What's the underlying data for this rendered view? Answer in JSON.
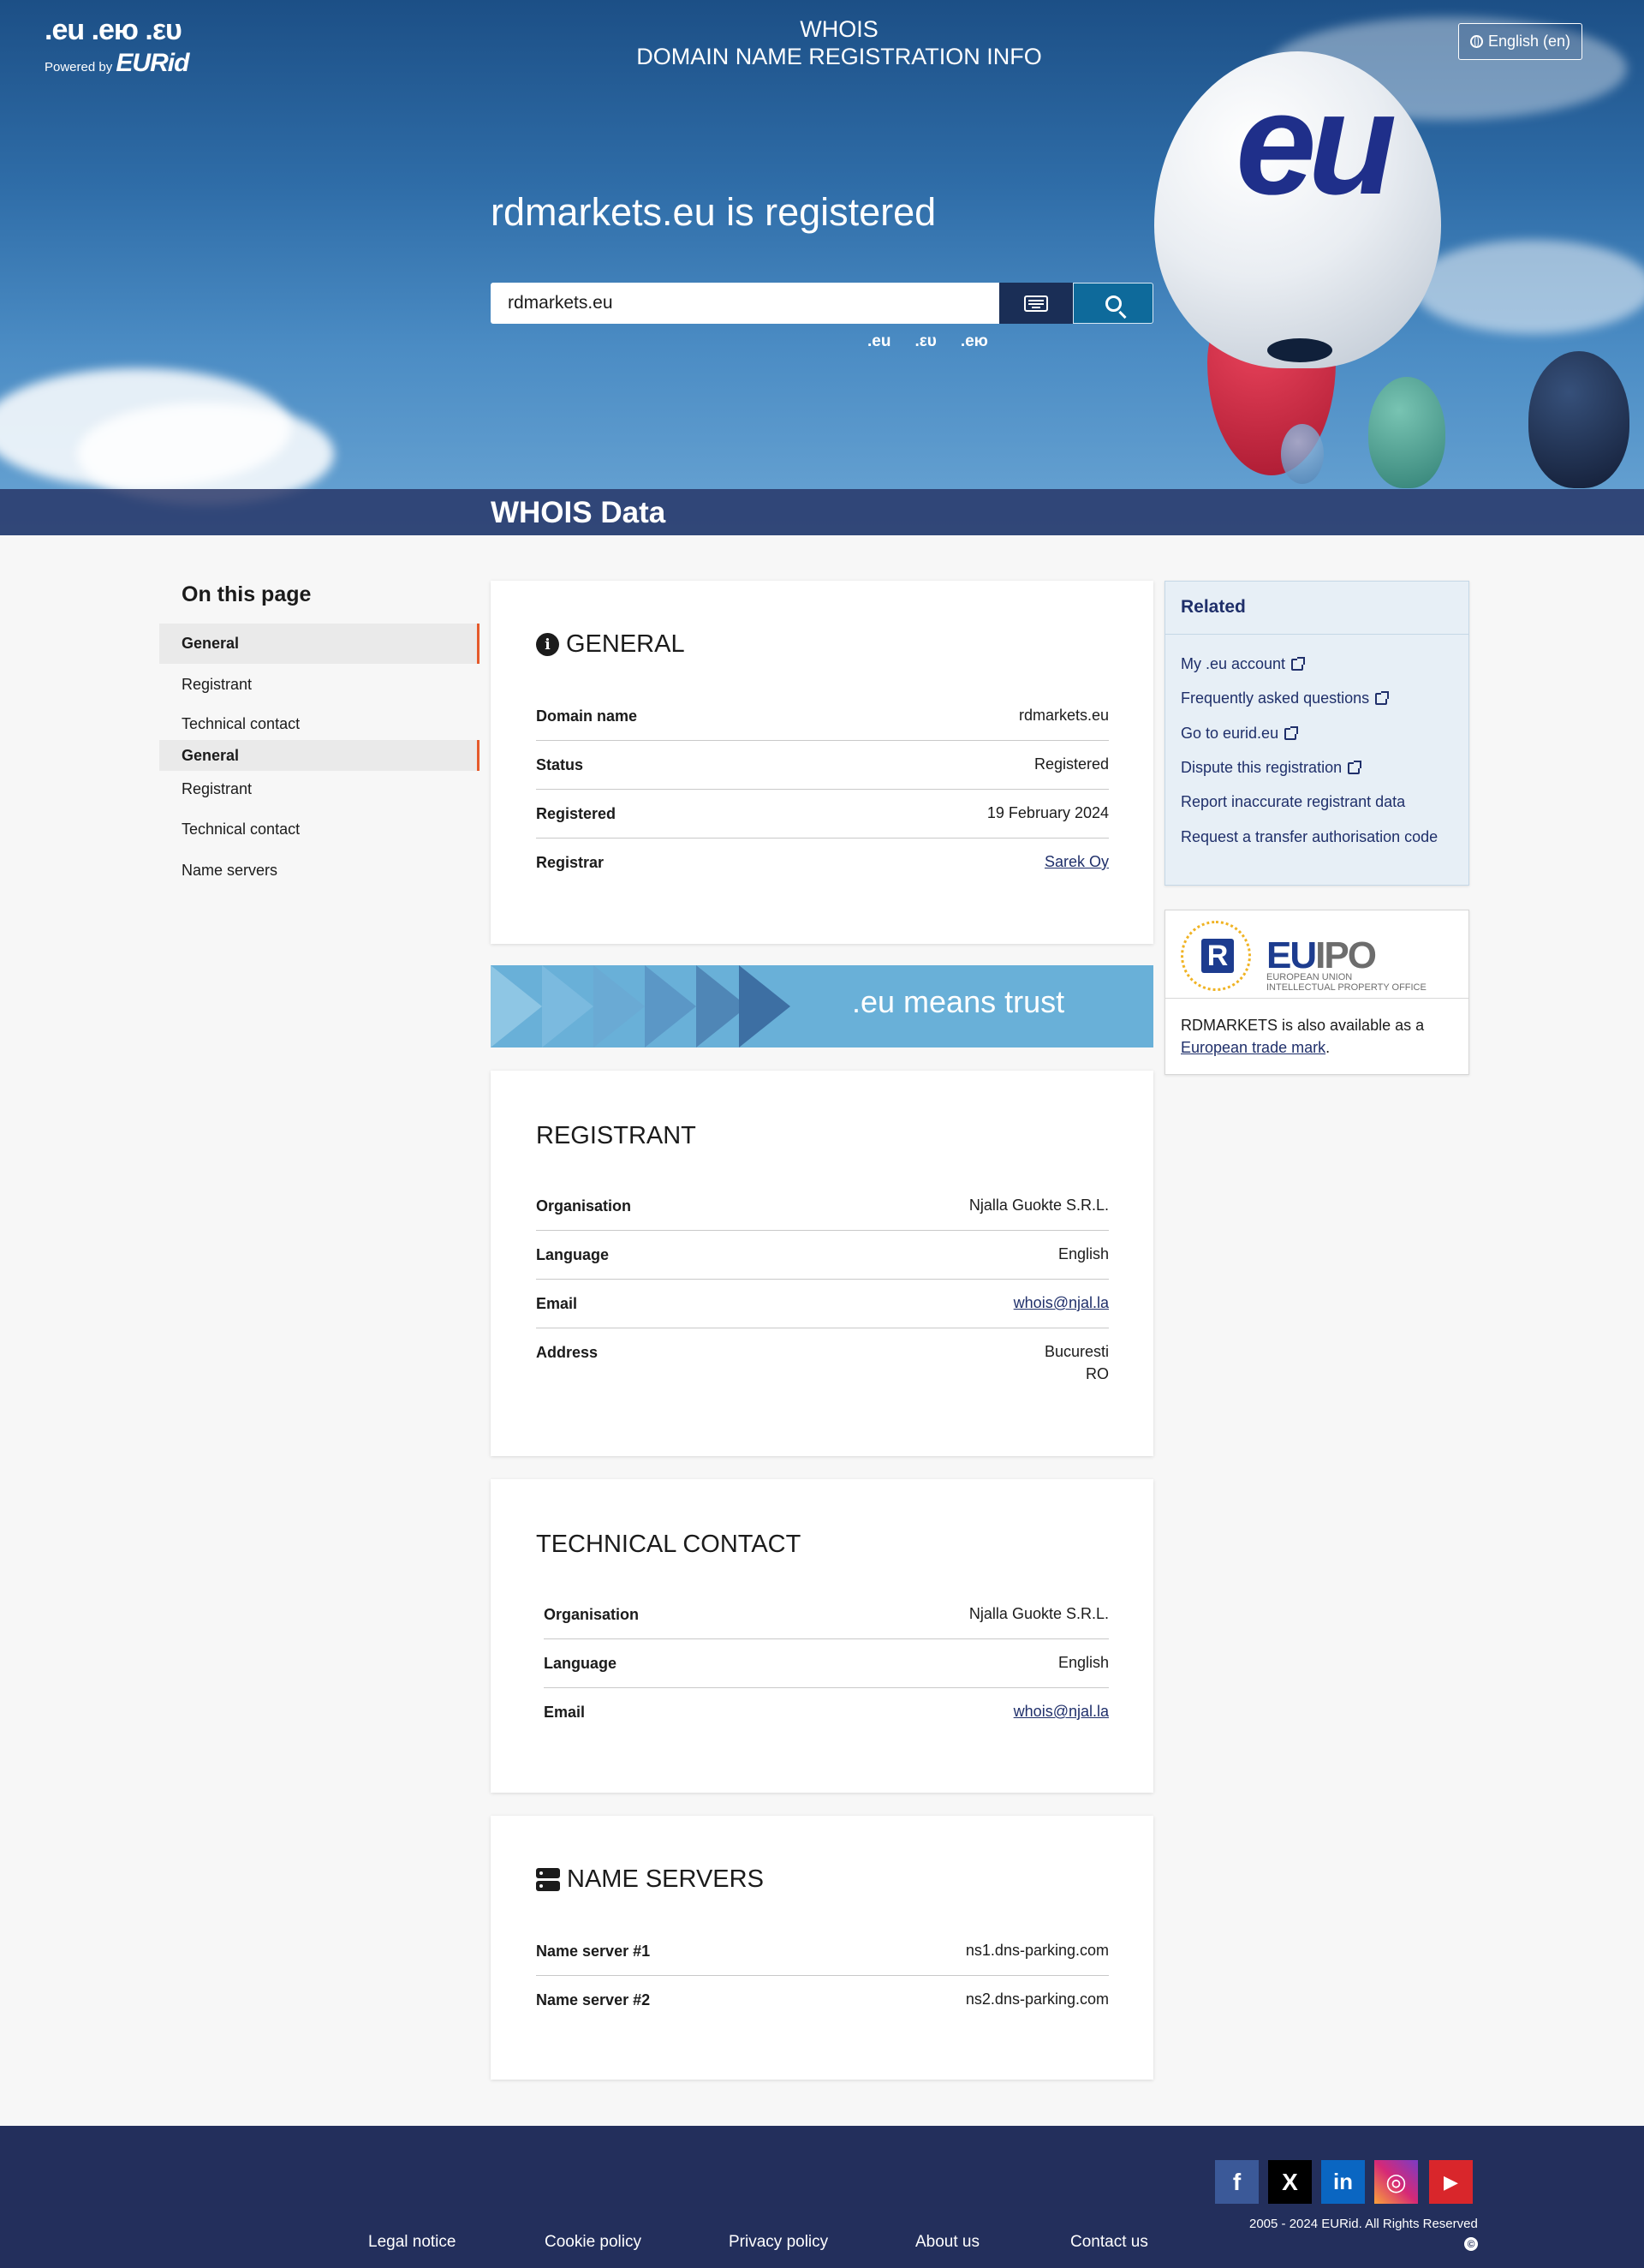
{
  "header": {
    "logo_tlds": ".eu .ею .ευ",
    "powered_by": "Powered by",
    "brand": "EURid",
    "title_line1": "WHOIS",
    "title_line2": "DOMAIN NAME REGISTRATION INFO",
    "language_button": "English (en)"
  },
  "hero": {
    "registered_title": "rdmarkets.eu is registered",
    "search_value": "rdmarkets.eu",
    "tld_options": [
      ".eu",
      ".ευ",
      ".ею"
    ],
    "balloon_text": "eu",
    "band_title": "WHOIS Data"
  },
  "nav": {
    "title": "On this page",
    "items": [
      "General",
      "Registrant",
      "Technical contact",
      "General",
      "Registrant",
      "Technical contact",
      "Name servers"
    ]
  },
  "general": {
    "title": "GENERAL",
    "rows": [
      {
        "key": "Domain name",
        "value": "rdmarkets.eu"
      },
      {
        "key": "Status",
        "value": "Registered"
      },
      {
        "key": "Registered",
        "value": "19 February 2024"
      },
      {
        "key": "Registrar",
        "value": "Sarek Oy"
      }
    ]
  },
  "trust_banner": ".eu means trust",
  "registrant": {
    "title": "REGISTRANT",
    "rows": [
      {
        "key": "Organisation",
        "value": "Njalla Guokte S.R.L."
      },
      {
        "key": "Language",
        "value": "English"
      },
      {
        "key": "Email",
        "value": "whois@njal.la"
      },
      {
        "key": "Address",
        "value": "Bucuresti",
        "value2": "RO"
      }
    ]
  },
  "technical": {
    "title": "TECHNICAL CONTACT",
    "rows": [
      {
        "key": "Organisation",
        "value": "Njalla Guokte S.R.L."
      },
      {
        "key": "Language",
        "value": "English"
      },
      {
        "key": "Email",
        "value": "whois@njal.la"
      }
    ]
  },
  "nameservers": {
    "title": "NAME SERVERS",
    "rows": [
      {
        "key": "Name server #1",
        "value": "ns1.dns-parking.com"
      },
      {
        "key": "Name server #2",
        "value": "ns2.dns-parking.com"
      }
    ]
  },
  "related": {
    "title": "Related",
    "links": [
      "My .eu account",
      "Frequently asked questions",
      "Go to eurid.eu",
      "Dispute this registration",
      "Report inaccurate registrant data",
      "Request a transfer authorisation code"
    ]
  },
  "euipo": {
    "r_letter": "R",
    "name_eu": "EU",
    "name_ipo": "IPO",
    "sub1": "EUROPEAN UNION",
    "sub2": "INTELLECTUAL PROPERTY OFFICE",
    "text_before": "RDMARKETS is also available as a",
    "link": "European trade mark",
    "text_after": "."
  },
  "footer": {
    "social": [
      "f",
      "X",
      "in",
      "◎",
      "▶"
    ],
    "copyright": "2005 - 2024 EURid. All Rights Reserved",
    "copy_symbol": "©",
    "links": [
      "Legal notice",
      "Cookie policy",
      "Privacy policy",
      "About us",
      "Contact us"
    ]
  },
  "colors": {
    "accent": "#e55a2b",
    "navy": "#232f5c",
    "link": "#1f2f6a",
    "search_button": "#0e6a9b"
  }
}
